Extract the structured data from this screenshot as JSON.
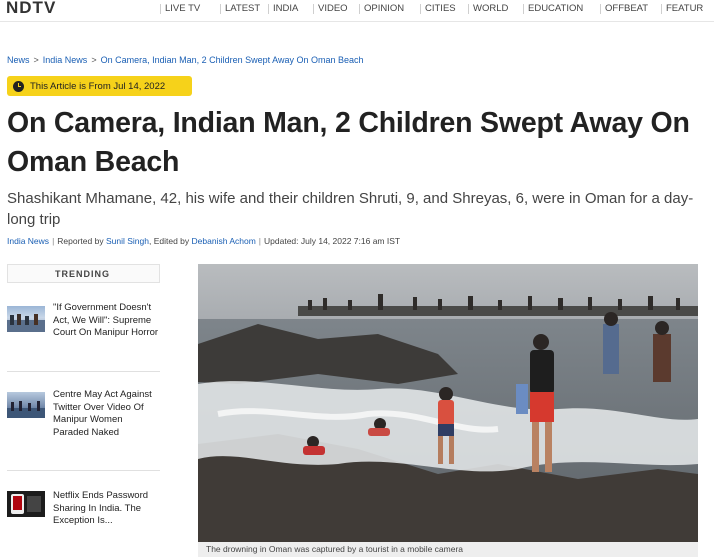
{
  "header": {
    "logo": "NDTV",
    "nav": [
      "LIVE TV",
      "LATEST",
      "INDIA",
      "VIDEO",
      "OPINION",
      "CITIES",
      "WORLD",
      "EDUCATION",
      "OFFBEAT",
      "FEATUR"
    ]
  },
  "breadcrumb": {
    "items": [
      "News",
      "India News",
      "On Camera, Indian Man, 2 Children Swept Away On Oman Beach"
    ]
  },
  "article": {
    "date_badge": "This Article is From Jul 14, 2022",
    "headline": "On Camera, Indian Man, 2 Children Swept Away On Oman Beach",
    "dek": "Shashikant Mhamane, 42, his wife and their children Shruti, 9, and Shreyas, 6, were in Oman for a day-long trip",
    "byline": {
      "category": "India News",
      "reported_prefix": "Reported by",
      "reporter": "Sunil Singh",
      "edited_prefix": ", Edited by",
      "editor": "Debanish Achom",
      "updated": "Updated: July 14, 2022 7:16 am IST"
    },
    "image_caption": "The drowning in Oman was captured by a tourist in a mobile camera"
  },
  "trending": {
    "title": "TRENDING",
    "items": [
      {
        "title": "\"If Government Doesn't Act, We Will\": Supreme Court On Manipur Horror"
      },
      {
        "title": "Centre May Act Against Twitter Over Video Of Manipur Women Paraded Naked"
      },
      {
        "title": "Netflix Ends Password Sharing In India. The Exception Is..."
      }
    ]
  },
  "colors": {
    "badge": "#f6d21a",
    "link": "#1a5fb4",
    "text": "#222222"
  }
}
